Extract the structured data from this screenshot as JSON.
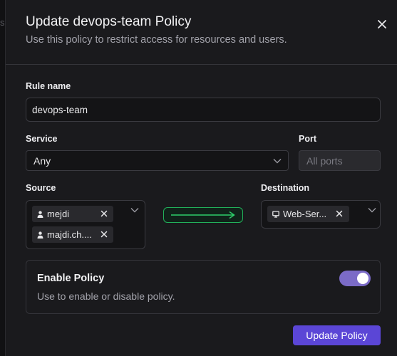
{
  "backdrop": {
    "fragment": "se"
  },
  "dialog": {
    "title": "Update devops-team Policy",
    "subtitle": "Use this policy to restrict access for resources and users."
  },
  "form": {
    "rule_name": {
      "label": "Rule name",
      "value": "devops-team"
    },
    "service": {
      "label": "Service",
      "value": "Any"
    },
    "port": {
      "label": "Port",
      "placeholder": "All ports"
    },
    "source": {
      "label": "Source",
      "chips": [
        {
          "label": "mejdi",
          "icon": "user-icon"
        },
        {
          "label": "majdi.ch....",
          "icon": "user-icon"
        }
      ]
    },
    "destination": {
      "label": "Destination",
      "chips": [
        {
          "label": "Web-Ser...",
          "icon": "monitor-icon"
        }
      ]
    },
    "enable": {
      "title": "Enable Policy",
      "description": "Use to enable or disable policy.",
      "enabled": true
    }
  },
  "actions": {
    "submit_label": "Update Policy"
  },
  "colors": {
    "accent": "#5b46d6",
    "toggle_on": "#7b6bc7",
    "flow_arrow": "#22b05a"
  }
}
